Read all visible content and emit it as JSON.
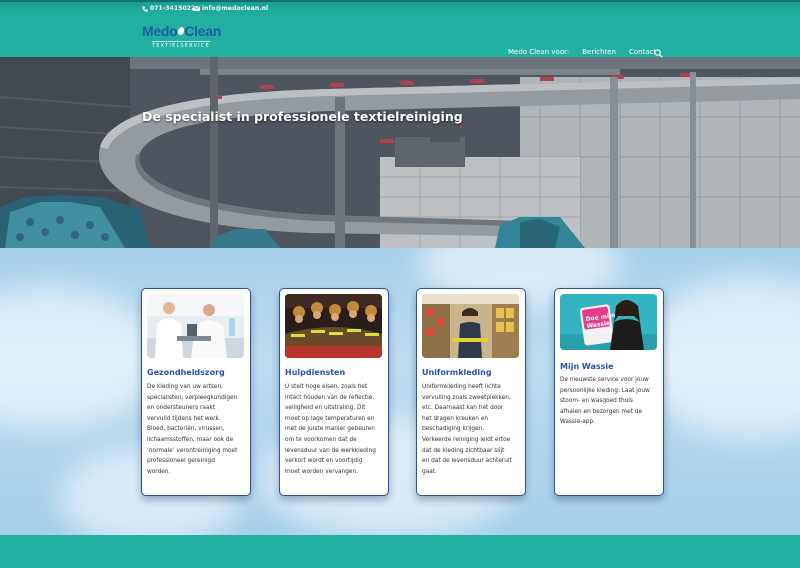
{
  "topbar": {
    "phone": "071-3415022",
    "email": "info@medoclean.nl"
  },
  "logo": {
    "part1": "Medo",
    "part2": "Clean",
    "subtitle": "TEXTIELSERVICE"
  },
  "nav": {
    "items": [
      "Medo Clean voor:",
      "Berichten",
      "Contact"
    ]
  },
  "hero": {
    "title": "De specialist in professionele textielreiniging"
  },
  "cards": [
    {
      "title": "Gezondheidszorg",
      "lines": [
        "De kleding van uw artsen,",
        "specialisten, verpleegkundigen",
        "en ondersteuners raakt",
        "vervuild tijdens het werk.",
        "Bloed, bacteriën, virussen,",
        "lichaamsstoffen, maar ook de",
        "‘normale’ verontreiniging moet",
        "professioneel gereinigd",
        "worden."
      ]
    },
    {
      "title": "Hulpdiensten",
      "lines": [
        "U stelt hoge eisen, zoals het",
        "intact houden van de reflectie,",
        "veiligheid en uitstraling. Dit",
        "moet op lage temperaturen en",
        "met de juiste manier gebeuren",
        "om te voorkomen dat de",
        "levensduur van de werkkleding",
        "verkort wordt en voortijdig",
        "moet worden vervangen."
      ]
    },
    {
      "title": "Uniformkleding",
      "lines": [
        "Uniformkleding heeft lichte",
        "vervuiling zoals zweetplekken,",
        "etc. Daarnaast kan het door",
        "het dragen kreuken en",
        "beschadiging krijgen.",
        "Verkeerde reiniging leidt ertoe",
        "dat de kleding zichtbaar slijt",
        "en dat de levensduur achteruit",
        "gaat."
      ]
    },
    {
      "title": "Mijn Wassie",
      "lines": [
        "De nieuwste service voor jouw",
        "persoonlijke kleding: Laat jouw",
        "stoom- en wasgoed thuis",
        "afhalen en bezorgen met de",
        "Wassie-app."
      ],
      "promo": {
        "line1": "Doe mijn",
        "line2": "Wassie"
      }
    }
  ]
}
